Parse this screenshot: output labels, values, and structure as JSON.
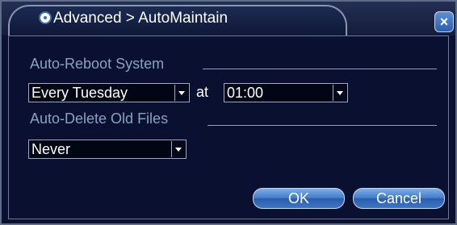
{
  "window": {
    "title": "Advanced > AutoMaintain",
    "close_label": "×"
  },
  "auto_reboot": {
    "label": "Auto-Reboot System",
    "day_value": "Every Tuesday",
    "at_label": "at",
    "time_value": "01:00"
  },
  "auto_delete": {
    "label": "Auto-Delete Old Files",
    "value": "Never"
  },
  "buttons": {
    "ok": "OK",
    "cancel": "Cancel"
  },
  "icons": {
    "title_icon": "settings-disc-icon",
    "close_icon": "close-icon",
    "dropdown_icon": "chevron-down-icon"
  }
}
